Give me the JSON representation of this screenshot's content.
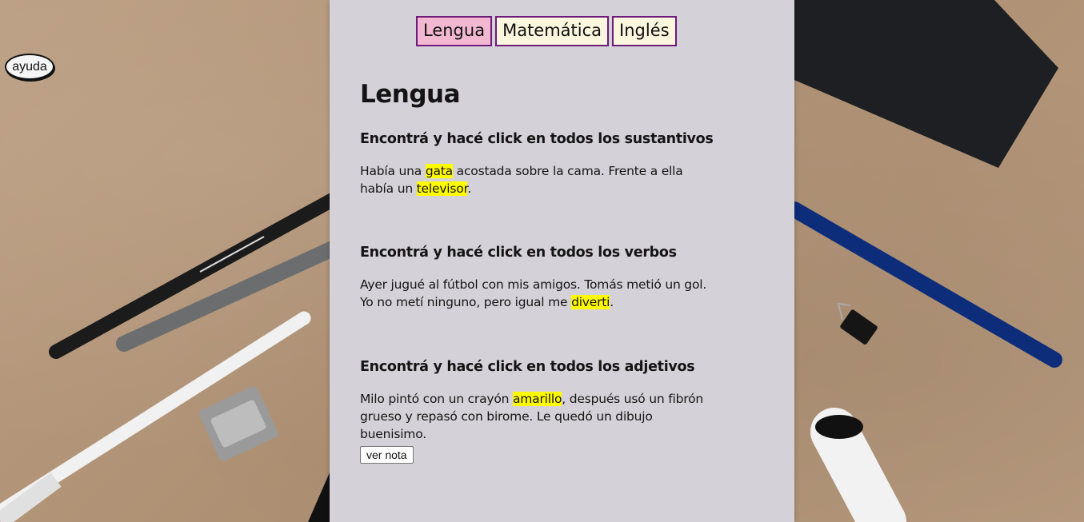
{
  "nav": {
    "tabs": [
      {
        "label": "Lengua",
        "active": true
      },
      {
        "label": "Matemática",
        "active": false
      },
      {
        "label": "Inglés",
        "active": false
      }
    ]
  },
  "help": {
    "label": "ayuda"
  },
  "main": {
    "title": "Lengua",
    "sections": [
      {
        "heading": "Encontrá y hacé click en todos los sustantivos",
        "parts": [
          "Había una ",
          "gata",
          " acostada sobre la cama. Frente a ella había un ",
          "televisor",
          "."
        ]
      },
      {
        "heading": "Encontrá y hacé click en todos los verbos",
        "parts": [
          "Ayer jugué al fútbol con mis amigos. Tomás metió un gol. Yo no metí ninguno, pero igual me ",
          "diverti",
          "."
        ]
      },
      {
        "heading": "Encontrá y hacé click en todos los adjetivos",
        "parts": [
          "Milo pintó con un crayón ",
          "amarillo",
          ", después usó un fibrón grueso y repasó con birome. Le quedó un dibujo buenisimo."
        ]
      }
    ],
    "grade_button": "ver nota"
  },
  "colors": {
    "tab_active_bg": "#f2b8d2",
    "tab_bg": "#fbf6de",
    "tab_border": "#6d1a7a",
    "highlight": "#fffb00",
    "sheet": "#d4d2d8"
  }
}
